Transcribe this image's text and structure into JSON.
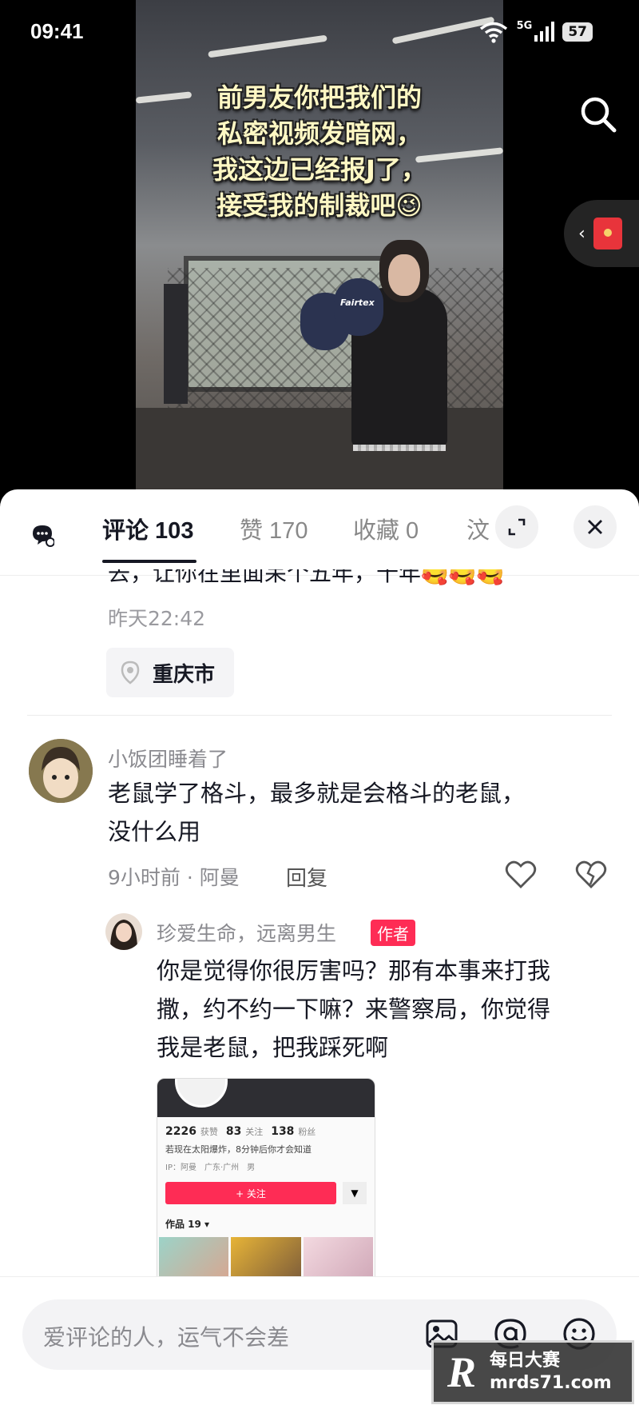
{
  "status_bar": {
    "time": "09:41",
    "network": "5G",
    "battery": "57"
  },
  "video": {
    "overlay_lines": [
      "前男友你把我们的",
      "私密视频发暗网，",
      "我这边已经报J了，",
      "接受我的制裁吧😉"
    ],
    "glove_brand": "Fairtex"
  },
  "tabs": [
    {
      "label": "评论 103",
      "active": true
    },
    {
      "label": "赞 170",
      "active": false
    },
    {
      "label": "收藏 0",
      "active": false
    },
    {
      "label": "汶",
      "active": false
    }
  ],
  "previous_comment": {
    "cut_text": "去，让你在里面呆个五年，十年🥰🥰🥰",
    "time": "昨天22:42",
    "location": "重庆市"
  },
  "comment": {
    "username": "小饭团睡着了",
    "lines": [
      "老鼠学了格斗，最多就是会格斗的老鼠，",
      "没什么用"
    ],
    "meta": "9小时前 · 阿曼",
    "reply_label": "回复"
  },
  "reply": {
    "username": "珍爱生命，远离男生",
    "badge": "作者",
    "lines": [
      "你是觉得你很厉害吗？那有本事来打我",
      "撒，约不约一下嘛？来警察局，你觉得",
      "我是老鼠，把我踩死啊"
    ]
  },
  "embedded_profile": {
    "stats": [
      {
        "num": "2226",
        "label": "获赞"
      },
      {
        "num": "83",
        "label": "关注"
      },
      {
        "num": "138",
        "label": "粉丝"
      }
    ],
    "bio": "若现在太阳爆炸，8分钟后你才会知道",
    "ip": [
      "IP：阿曼",
      "广东·广州",
      "男"
    ],
    "follow_label": "+ 关注",
    "dropdown_label": "▼",
    "works_label": "作品 19 ▾"
  },
  "input": {
    "placeholder": "爱评论的人，运气不会差"
  },
  "watermark": {
    "logo_letter": "R",
    "line1": "每日大赛",
    "line2": "mrds71.com"
  },
  "colors": {
    "accent": "#fe2c55",
    "text": "#161823",
    "muted": "#8a8a8f"
  }
}
